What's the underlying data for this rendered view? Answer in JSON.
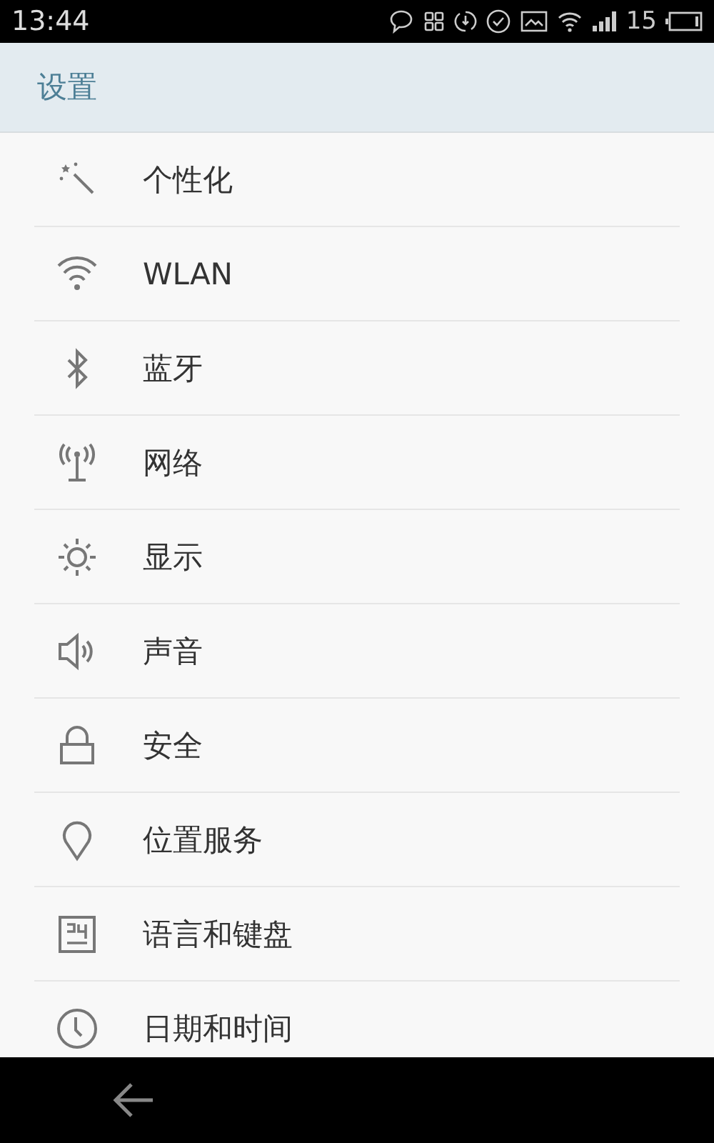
{
  "status_bar": {
    "time": "13:44",
    "battery_text": "15"
  },
  "header": {
    "title": "设置"
  },
  "items": [
    {
      "kind": "personalize",
      "label": "个性化"
    },
    {
      "kind": "wifi",
      "label": "WLAN"
    },
    {
      "kind": "bluetooth",
      "label": "蓝牙"
    },
    {
      "kind": "network",
      "label": "网络"
    },
    {
      "kind": "display",
      "label": "显示"
    },
    {
      "kind": "sound",
      "label": "声音"
    },
    {
      "kind": "security",
      "label": "安全"
    },
    {
      "kind": "location",
      "label": "位置服务"
    },
    {
      "kind": "language",
      "label": "语言和键盘"
    },
    {
      "kind": "datetime",
      "label": "日期和时间"
    }
  ]
}
